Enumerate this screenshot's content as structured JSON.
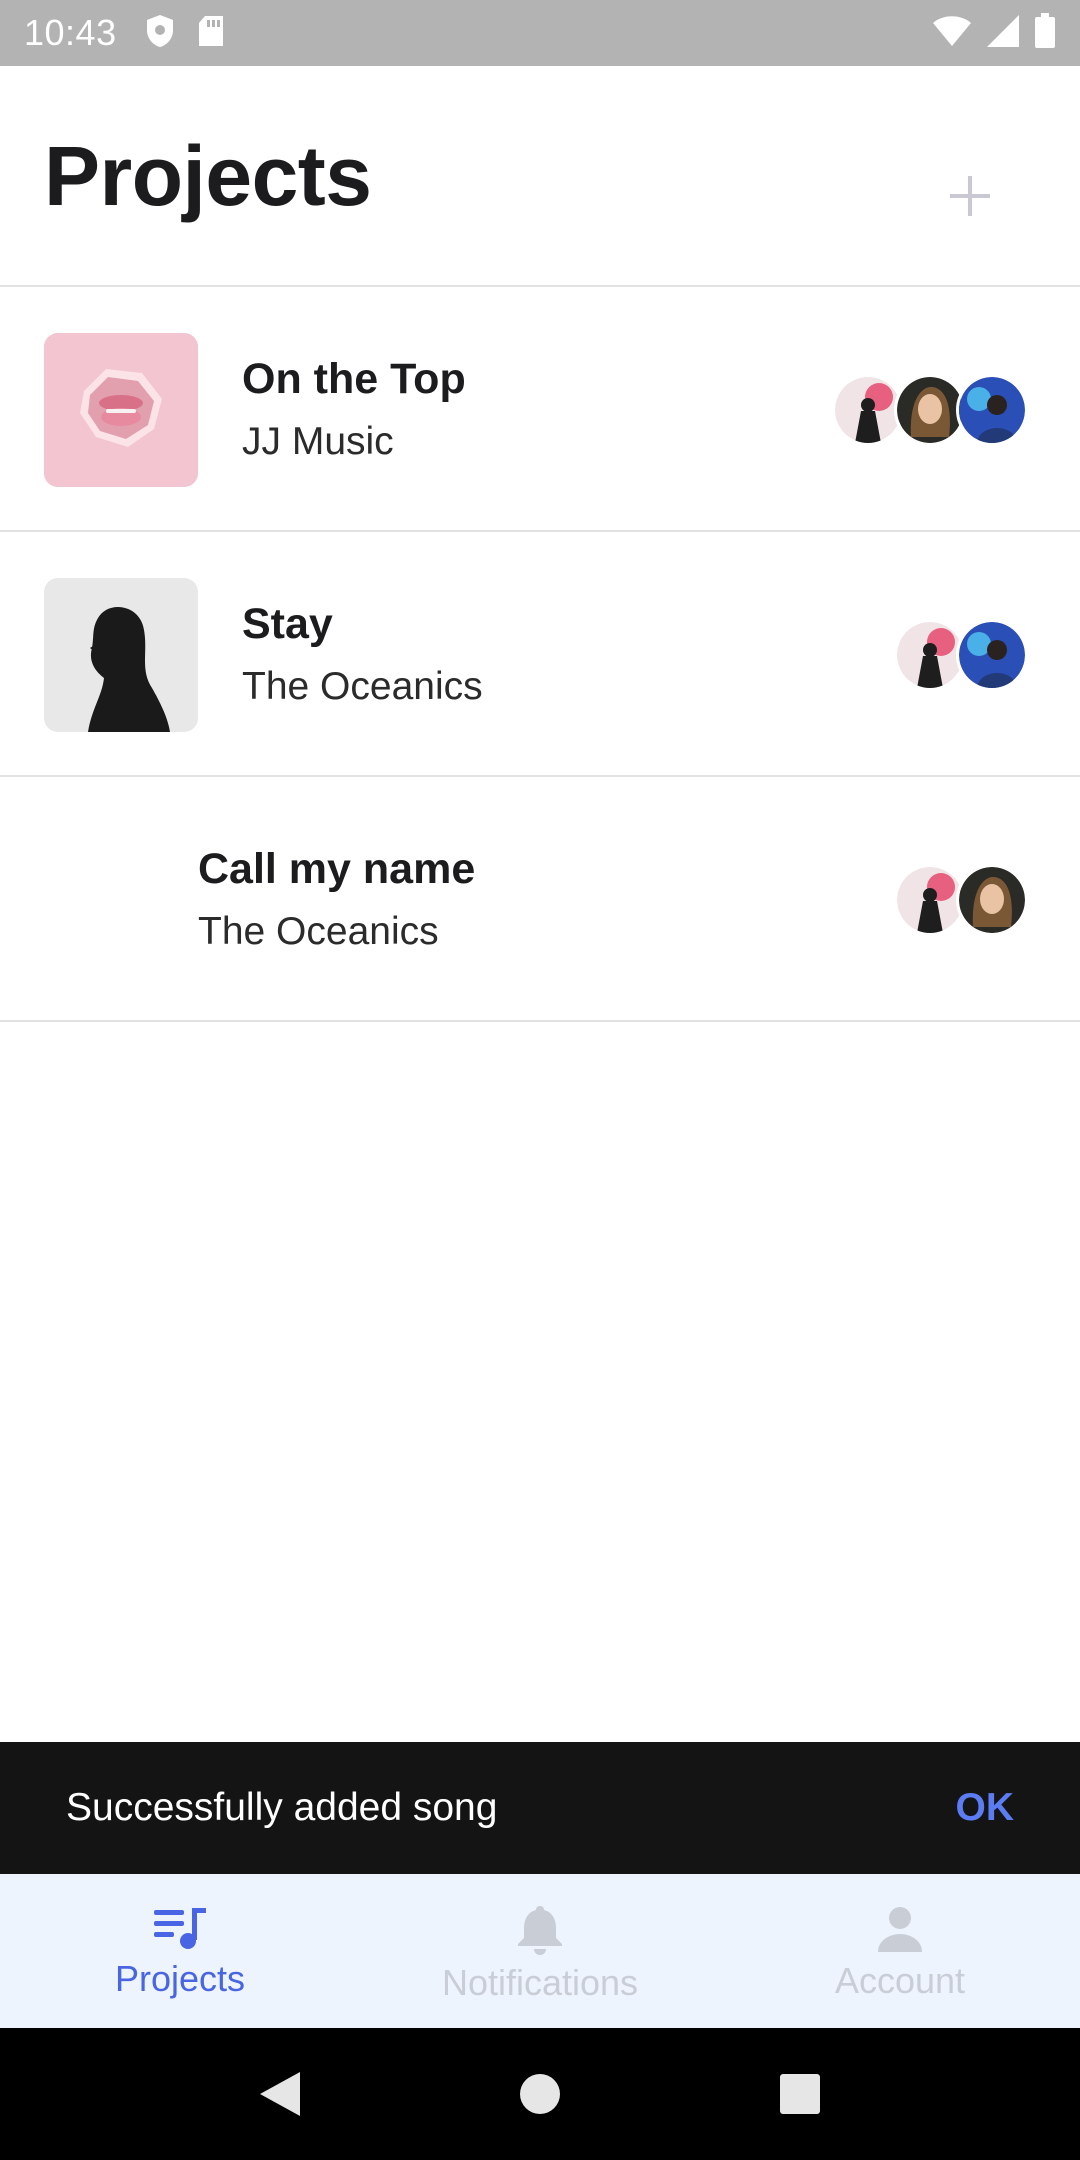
{
  "status_bar": {
    "time": "10:43"
  },
  "header": {
    "title": "Projects",
    "add_icon": "plus-icon"
  },
  "projects": [
    {
      "title": "On the Top",
      "artist": "JJ Music",
      "cover": "lips-art",
      "avatars": [
        "collaborator-1",
        "collaborator-2",
        "collaborator-3"
      ]
    },
    {
      "title": "Stay",
      "artist": "The Oceanics",
      "cover": "bw-portrait",
      "avatars": [
        "collaborator-1",
        "collaborator-3"
      ]
    },
    {
      "title": "Call my name",
      "artist": "The Oceanics",
      "cover": "none",
      "avatars": [
        "collaborator-1",
        "collaborator-2"
      ]
    }
  ],
  "snackbar": {
    "message": "Successfully added song",
    "action": "OK"
  },
  "bottom_nav": {
    "items": [
      {
        "label": "Projects",
        "icon": "playlist-music-icon",
        "active": true
      },
      {
        "label": "Notifications",
        "icon": "bell-icon",
        "active": false
      },
      {
        "label": "Account",
        "icon": "person-icon",
        "active": false
      }
    ]
  },
  "colors": {
    "accent": "#4a65e3",
    "snackbar_action": "#5b7cf2",
    "nav_background": "#eef4fd",
    "status_bar": "#b3b3b3"
  }
}
